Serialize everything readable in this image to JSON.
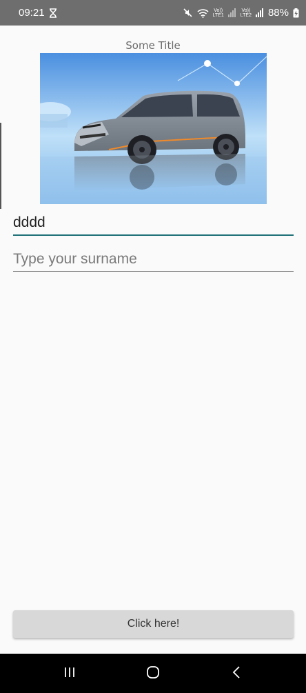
{
  "status_bar": {
    "time": "09:21",
    "battery_percent": "88%",
    "net_label_1_top": "Vo))",
    "net_label_1_bottom": "LTE1",
    "net_label_2_top": "Vo))",
    "net_label_2_bottom": "LTE2",
    "icons": [
      "hourglass-icon",
      "mute-icon",
      "wifi-icon",
      "signal-icon",
      "signal-icon",
      "battery-charging-icon"
    ]
  },
  "page": {
    "title": "Some Title",
    "hero_image": "car-photo"
  },
  "form": {
    "name_value": "dddd",
    "surname_placeholder": "Type your surname",
    "surname_value": ""
  },
  "action": {
    "button_label": "Click here!"
  },
  "nav_bar": {
    "icons": [
      "recent-apps-icon",
      "home-icon",
      "back-icon"
    ]
  },
  "colors": {
    "status_bar": "#6e6e6e",
    "accent_underline": "#1d6f78",
    "background": "#fafafa",
    "button": "#d8d8d8",
    "nav_bar": "#000000"
  }
}
